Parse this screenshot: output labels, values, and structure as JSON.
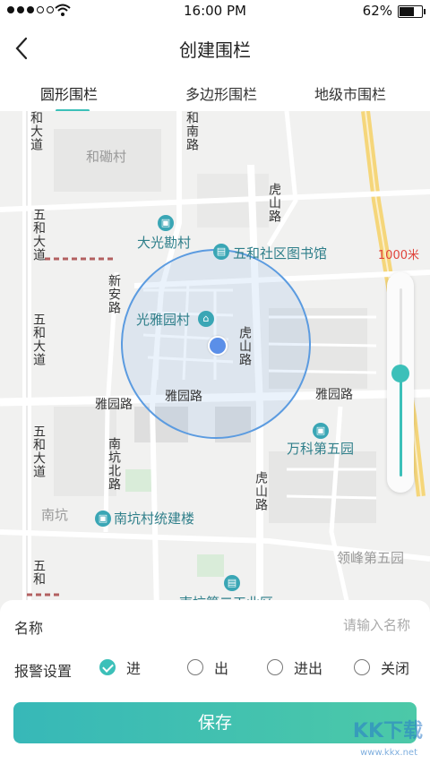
{
  "status_bar": {
    "time": "16:00  PM",
    "battery": "62%",
    "battery_level": 0.62
  },
  "nav": {
    "title": "创建围栏"
  },
  "tabs": [
    {
      "label": "圆形围栏",
      "active": true
    },
    {
      "label": "多边形围栏",
      "active": false
    },
    {
      "label": "地级市围栏",
      "active": false
    }
  ],
  "map": {
    "radius_label": "1000米",
    "zoom_level": 0.55,
    "labels": {
      "hemiancun": "和磡村",
      "henanlu": "和南路",
      "wuheda_1": "和大道",
      "wuheda_2": "五和大道",
      "wuheda_3": "五和大道",
      "wuheda_4": "五和大道",
      "wuheda_5": "五和",
      "hushanlu_1": "虎山路",
      "hushanlu_2": "虎山路",
      "hushanlu_3": "虎山路",
      "daguangkancun": "大光勘村",
      "library": "五和社区图书馆",
      "xinanlu": "新安路",
      "guangyayuancun": "光雅园村",
      "yayuanlu_1": "雅园路",
      "yayuanlu_2": "雅园路",
      "yayuanlu_3": "雅园路",
      "wanke": "万科第五园",
      "nankengbeilu": "南坑北路",
      "nankeng": "南坑",
      "nankengcun": "南坑村统建楼",
      "lingfeng": "领峰第五园",
      "bottom_poi": "南坑第二工业区"
    }
  },
  "form": {
    "name_label": "名称",
    "name_placeholder": "请输入名称",
    "name_value": "",
    "alarm_label": "报警设置",
    "options": [
      {
        "label": "进",
        "checked": true
      },
      {
        "label": "出",
        "checked": false
      },
      {
        "label": "进出",
        "checked": false
      },
      {
        "label": "关闭",
        "checked": false
      }
    ],
    "save_label": "保存"
  },
  "watermark": {
    "text": "KK下载",
    "url": "www.kkx.net"
  },
  "colors": {
    "accent": "#3cc0b9",
    "radius_text": "#e0443c",
    "fence_circle": "#5b9be0",
    "location_dot": "#5b8fe8",
    "highway": "#f5d67a"
  }
}
